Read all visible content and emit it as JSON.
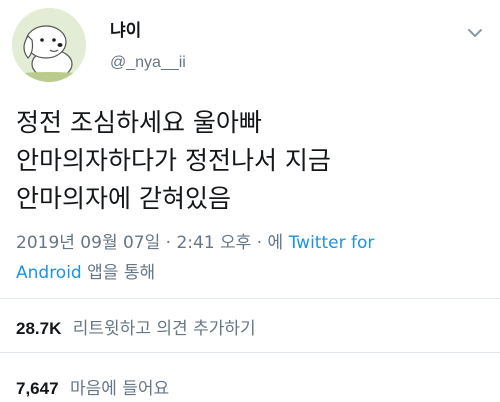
{
  "author": {
    "display_name": "냐이",
    "username": "@_nya__ii",
    "avatar_icon": "dog-cartoon-avatar-icon"
  },
  "menu_icon": "chevron-down-icon",
  "tweet": {
    "lines": [
      "정전 조심하세요 울아빠",
      "안마의자하다가 정전나서 지금",
      "안마의자에 갇혀있음"
    ]
  },
  "meta": {
    "timestamp": "2019년 09월 07일 · 2:41 오후 · 에",
    "source_line1": "Twitter for",
    "source_line2": "Android",
    "source_suffix": "앱을 통해"
  },
  "stats": {
    "retweets_count": "28.7K",
    "retweets_label": "리트윗하고 의견 추가하기",
    "likes_count": "7,647",
    "likes_label": "마음에 들어요"
  },
  "colors": {
    "text": "#14171a",
    "secondary": "#657786",
    "link": "#1b95e0",
    "divider": "#e1e8ed"
  }
}
